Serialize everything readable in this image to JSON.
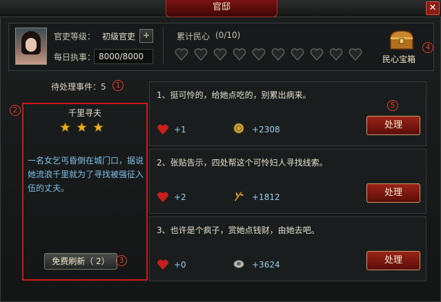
{
  "window": {
    "title": "官邸",
    "close_label": "✕"
  },
  "profile": {
    "rank_label": "官吏等级：",
    "rank_value": "初级官吏",
    "rank_up_label": "+",
    "duty_label": "每日执事：",
    "duty_value": "8000/8000"
  },
  "morale": {
    "label": "累计民心",
    "count": "(0/10)",
    "filled": 0,
    "total": 10
  },
  "treasure": {
    "label": "民心宝箱"
  },
  "pending": {
    "label": "待处理事件：5"
  },
  "story": {
    "title": "千里寻夫",
    "stars": 3,
    "text": "一名女乞丐昏倒在城门口，据说她流浪千里就为了寻找被强征入伍的丈夫。",
    "refresh_label": "免费刷新（ 2）"
  },
  "events": [
    {
      "text": "1、挺可怜的，给她点吃的，别累出病来。",
      "morale_gain": "+1",
      "resource_icon": "coin-icon",
      "resource_value": "+2308",
      "action": "处理"
    },
    {
      "text": "2、张贴告示，四处帮这个可怜妇人寻找线索。",
      "morale_gain": "+2",
      "resource_icon": "wheat-icon",
      "resource_value": "+1812",
      "action": "处理"
    },
    {
      "text": "3、也许是个疯子，赏她点钱财，由她去吧。",
      "morale_gain": "+0",
      "resource_icon": "silver-icon",
      "resource_value": "+3624",
      "action": "处理"
    }
  ],
  "markers": [
    "1",
    "2",
    "3",
    "4",
    "5"
  ],
  "colors": {
    "accent_red": "#9a2318",
    "marker_red": "#e53a2a",
    "text_blue": "#7ec0e6",
    "heart_red": "#c81e1e"
  }
}
